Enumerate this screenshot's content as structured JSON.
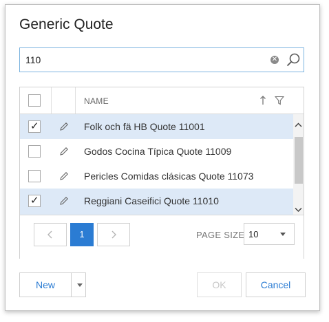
{
  "dialog": {
    "title": "Generic Quote"
  },
  "search": {
    "value": "110",
    "placeholder": ""
  },
  "grid": {
    "columns": {
      "name": "NAME"
    },
    "rows": [
      {
        "label": "Folk och fä HB Quote 11001",
        "checked": true,
        "selected": true
      },
      {
        "label": "Godos Cocina Típica Quote 11009",
        "checked": false,
        "selected": false
      },
      {
        "label": "Pericles Comidas clásicas Quote 11073",
        "checked": false,
        "selected": false
      },
      {
        "label": "Reggiani Caseifici Quote 11010",
        "checked": true,
        "selected": true
      }
    ]
  },
  "pager": {
    "current_page": "1",
    "page_size_label": "PAGE SIZE",
    "page_size": "10"
  },
  "footer": {
    "new_label": "New",
    "ok_label": "OK",
    "cancel_label": "Cancel"
  },
  "colors": {
    "accent": "#2b7cd3",
    "selected_row": "#dde9f7",
    "search_border": "#7bb3df"
  },
  "icons": {
    "clear": "clear-icon",
    "search": "search-icon",
    "edit": "pencil-icon",
    "sort": "sort-ascending-icon",
    "filter": "filter-icon",
    "prev": "chevron-left-icon",
    "next": "chevron-right-icon",
    "dropdown": "caret-down-icon",
    "scroll_up": "chevron-up-icon",
    "scroll_down": "chevron-down-icon"
  }
}
